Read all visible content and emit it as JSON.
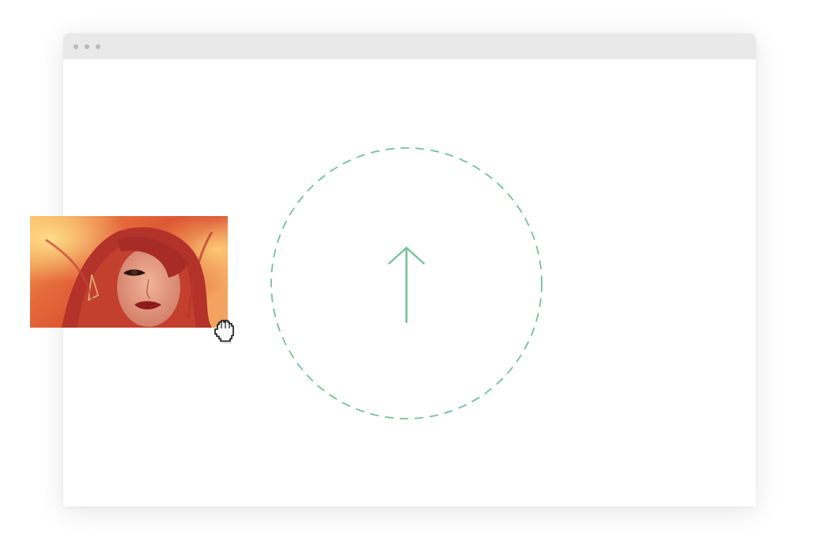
{
  "window": {
    "titlebar_dots": [
      "dot",
      "dot",
      "dot"
    ]
  },
  "dropzone": {
    "icon": "upload-arrow-icon",
    "accent_color": "#72c29b"
  },
  "dragged_image": {
    "subject": "photo-thumbnail"
  },
  "cursor": {
    "icon": "grab-hand-cursor-icon"
  }
}
